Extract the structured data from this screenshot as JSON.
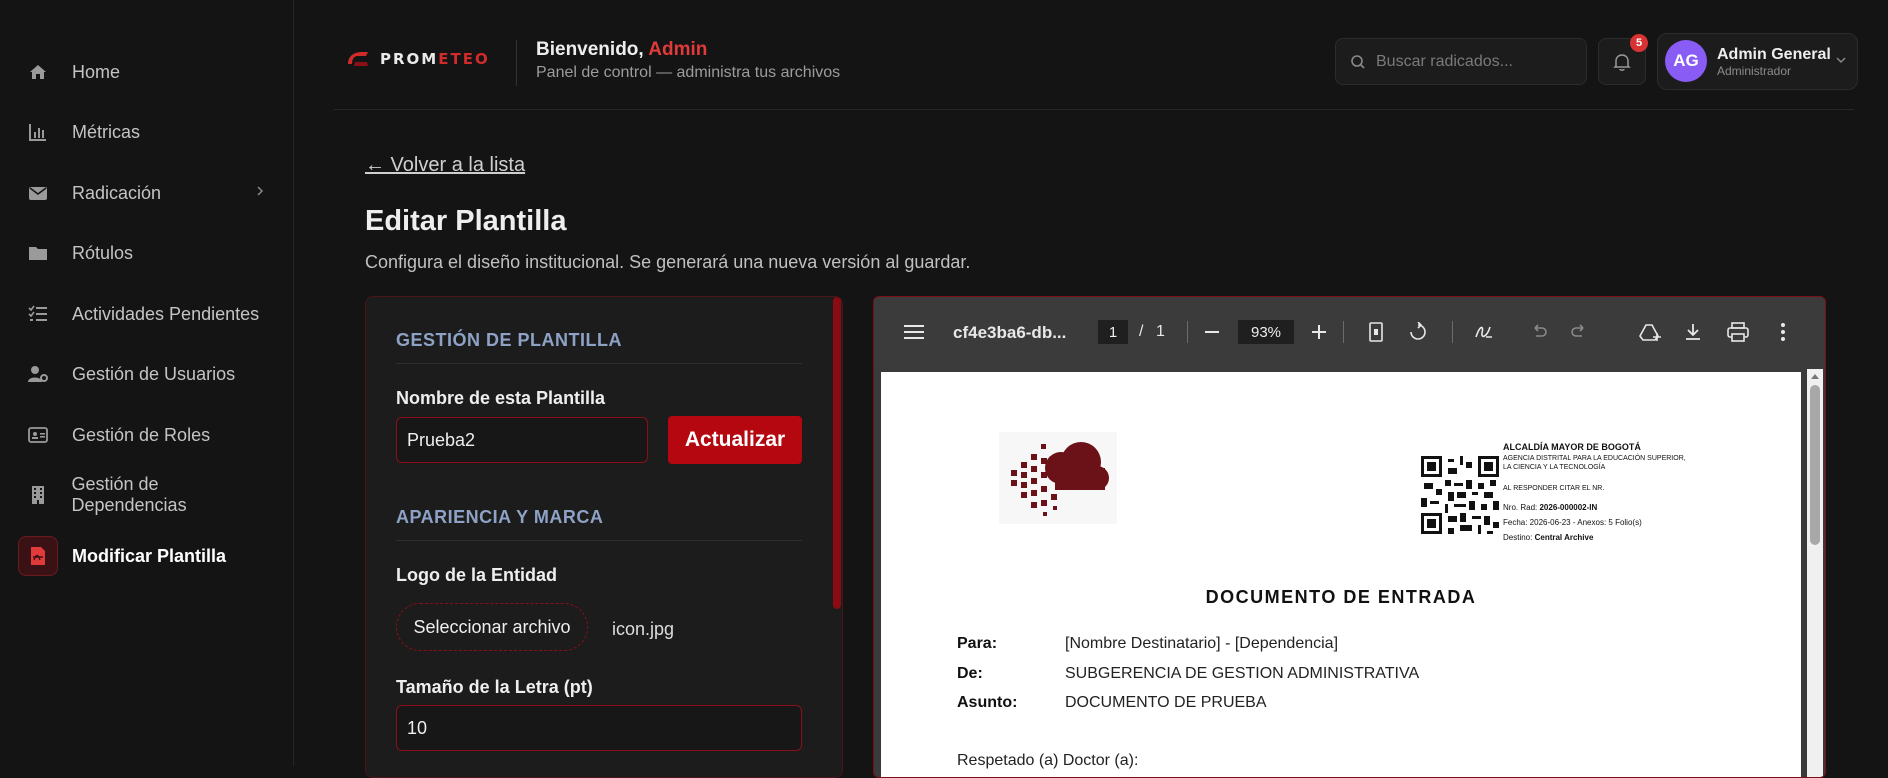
{
  "sidebar": {
    "items": [
      {
        "label": "Home",
        "icon": "home-icon"
      },
      {
        "label": "Métricas",
        "icon": "chart-icon"
      },
      {
        "label": "Radicación",
        "icon": "mail-icon"
      },
      {
        "label": "Rótulos",
        "icon": "folder-icon"
      },
      {
        "label": "Actividades Pendientes",
        "icon": "list-check-icon"
      },
      {
        "label": "Gestión de Usuarios",
        "icon": "user-gear-icon"
      },
      {
        "label": "Gestión de Roles",
        "icon": "id-card-icon"
      },
      {
        "label": "Gestión de Dependencias",
        "icon": "building-icon"
      },
      {
        "label": "Modificar Plantilla",
        "icon": "pdf-file-icon"
      }
    ]
  },
  "header": {
    "logo_a": "PROM",
    "logo_b": "ETEO",
    "greeting": "Bienvenido,",
    "user_name": "Admin",
    "subtitle": "Panel de control — administra tus archivos",
    "search_placeholder": "Buscar radicados...",
    "notifications": "5",
    "avatar_initials": "AG",
    "account_name": "Admin General",
    "account_role": "Administrador"
  },
  "main": {
    "back_link": "← Volver a la lista",
    "title": "Editar Plantilla",
    "description": "Configura el diseño institucional. Se generará una nueva versión al guardar."
  },
  "form": {
    "section1": "GESTIÓN DE PLANTILLA",
    "name_label": "Nombre de esta Plantilla",
    "name_value": "Prueba2",
    "update_button": "Actualizar",
    "section2": "APARIENCIA Y MARCA",
    "logo_label": "Logo de la Entidad",
    "file_button": "Seleccionar archivo",
    "file_name": "icon.jpg",
    "font_label": "Tamaño de la Letra (pt)",
    "font_value": "10"
  },
  "viewer": {
    "filename": "cf4e3ba6-db...",
    "page_current": "1",
    "page_sep": "/",
    "page_total": "1",
    "zoom": "93%"
  },
  "document": {
    "entity": "ALCALDÍA MAYOR DE BOGOTÁ",
    "agency_1": "AGENCIA DISTRITAL PARA LA EDUCACIÓN SUPERIOR,",
    "agency_2": "LA CIENCIA Y LA TECNOLOGÍA",
    "reply_note": "AL RESPONDER CITAR EL NR.",
    "rad_label": "Nro. Rad:",
    "rad_value": "2026-000002-IN",
    "date_line": "Fecha: 2026-06-23 - Anexos: 5 Folio(s)",
    "dest_label": "Destino:",
    "dest_value": "Central Archive",
    "title": "DOCUMENTO DE ENTRADA",
    "para_label": "Para:",
    "para_value": "[Nombre Destinatario] - [Dependencia]",
    "de_label": "De:",
    "de_value": "SUBGERENCIA DE GESTION ADMINISTRATIVA",
    "asunto_label": "Asunto:",
    "asunto_value": "DOCUMENTO DE PRUEBA",
    "salutation": "Respetado (a) Doctor (a):"
  },
  "colors": {
    "accent": "#b5070f",
    "background": "#141414",
    "section_title": "#8ea2c6",
    "avatar": "#8a5cf6",
    "logo_cloud": "#6b1118"
  }
}
